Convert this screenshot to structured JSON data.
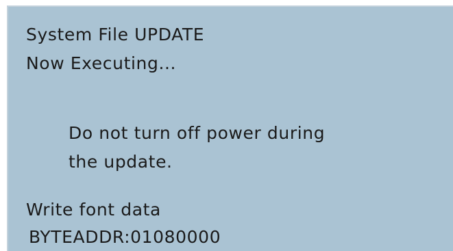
{
  "header": {
    "title": "System File UPDATE",
    "status": "Now Executing..."
  },
  "warning": {
    "line1": "Do not turn off power during",
    "line2": "the update."
  },
  "progress": {
    "task": "Write font data",
    "address": "BYTEADDR:01080000"
  },
  "colors": {
    "screen_background": "#aac3d3",
    "text": "#1a1a1a"
  }
}
